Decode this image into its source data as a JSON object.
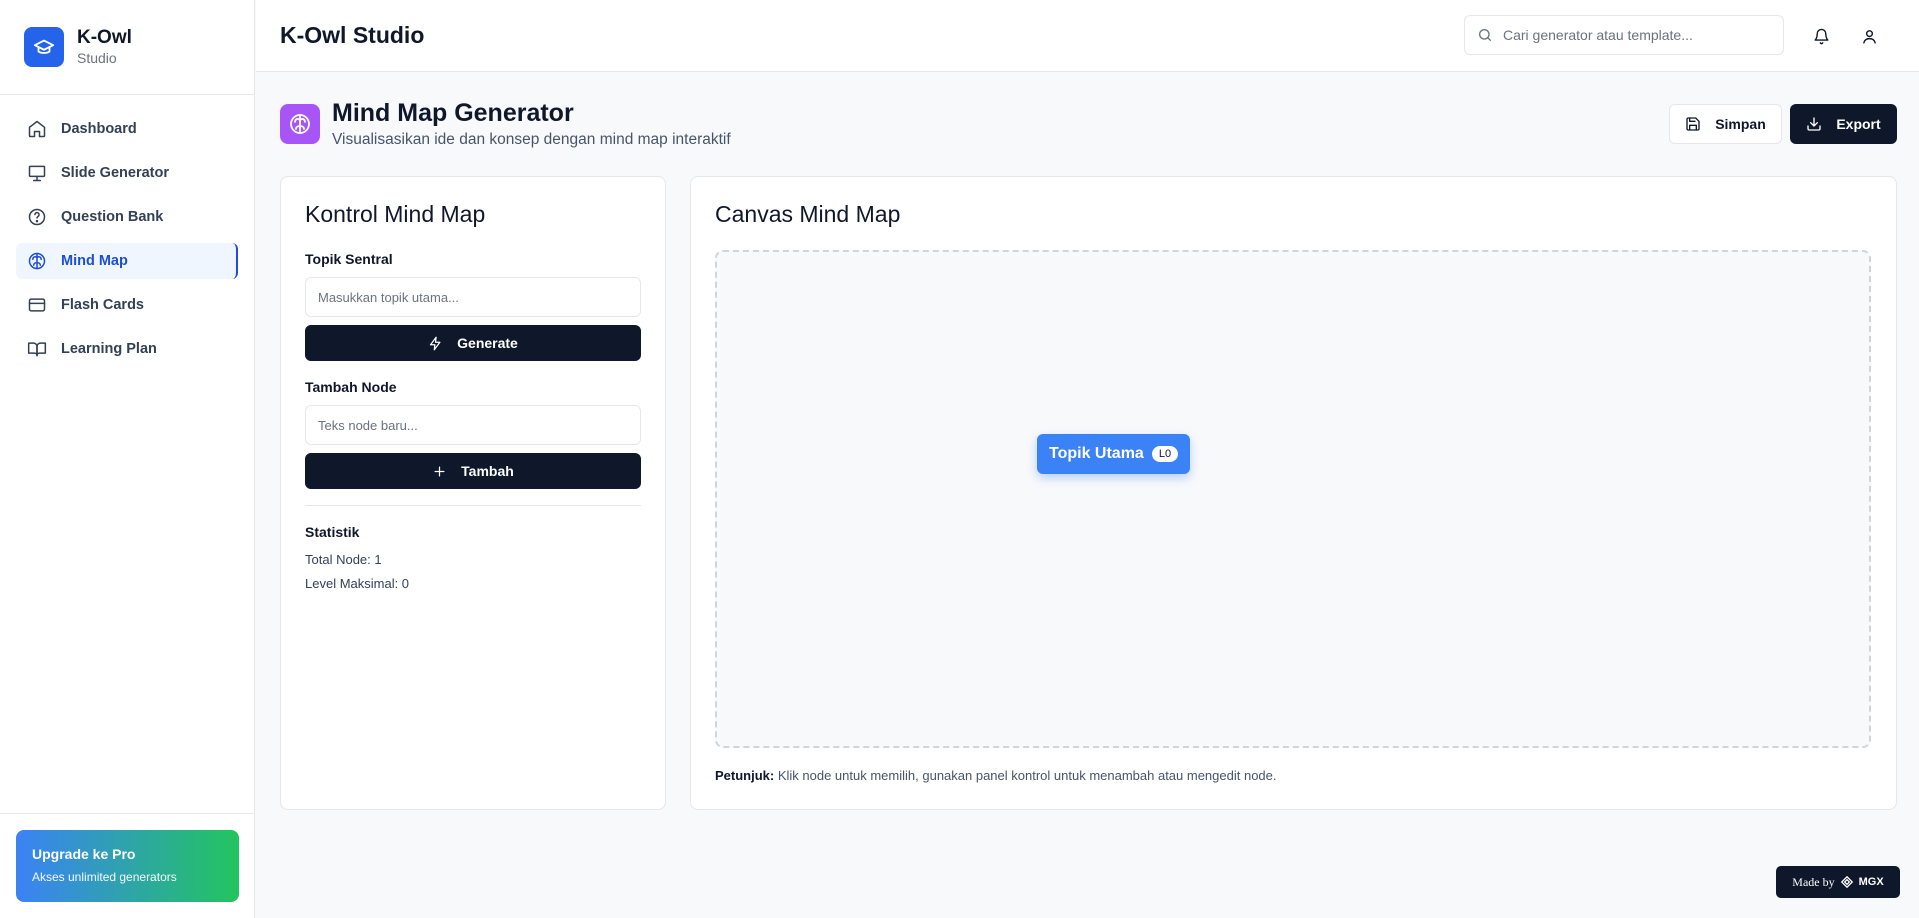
{
  "brand": {
    "name": "K-Owl",
    "sub": "Studio"
  },
  "sidebar": {
    "items": [
      {
        "label": "Dashboard",
        "icon": "home-icon"
      },
      {
        "label": "Slide Generator",
        "icon": "presentation-icon"
      },
      {
        "label": "Question Bank",
        "icon": "help-circle-icon"
      },
      {
        "label": "Mind Map",
        "icon": "brain-icon",
        "active": true
      },
      {
        "label": "Flash Cards",
        "icon": "credit-card-icon"
      },
      {
        "label": "Learning Plan",
        "icon": "book-open-icon"
      }
    ],
    "upgrade": {
      "title": "Upgrade ke Pro",
      "subtitle": "Akses unlimited generators"
    }
  },
  "header": {
    "title": "K-Owl Studio",
    "search_placeholder": "Cari generator atau template..."
  },
  "page": {
    "title": "Mind Map Generator",
    "subtitle": "Visualisasikan ide dan konsep dengan mind map interaktif",
    "save_label": "Simpan",
    "export_label": "Export"
  },
  "controls": {
    "title": "Kontrol Mind Map",
    "topic_label": "Topik Sentral",
    "topic_placeholder": "Masukkan topik utama...",
    "generate_label": "Generate",
    "node_label": "Tambah Node",
    "node_placeholder": "Teks node baru...",
    "add_label": "Tambah",
    "stats_title": "Statistik",
    "total_nodes": "Total Node: 1",
    "max_level": "Level Maksimal: 0"
  },
  "canvas": {
    "title": "Canvas Mind Map",
    "root_node": "Topik Utama",
    "root_level": "L0",
    "hint_label": "Petunjuk:",
    "hint_text": " Klik node untuk memilih, gunakan panel kontrol untuk menambah atau mengedit node."
  },
  "badge": {
    "made_by": "Made by",
    "brand": "MGX"
  },
  "colors": {
    "primary": "#2563eb",
    "dark": "#0f172a",
    "node": "#3b82f6",
    "page_icon": "#a855f7"
  }
}
